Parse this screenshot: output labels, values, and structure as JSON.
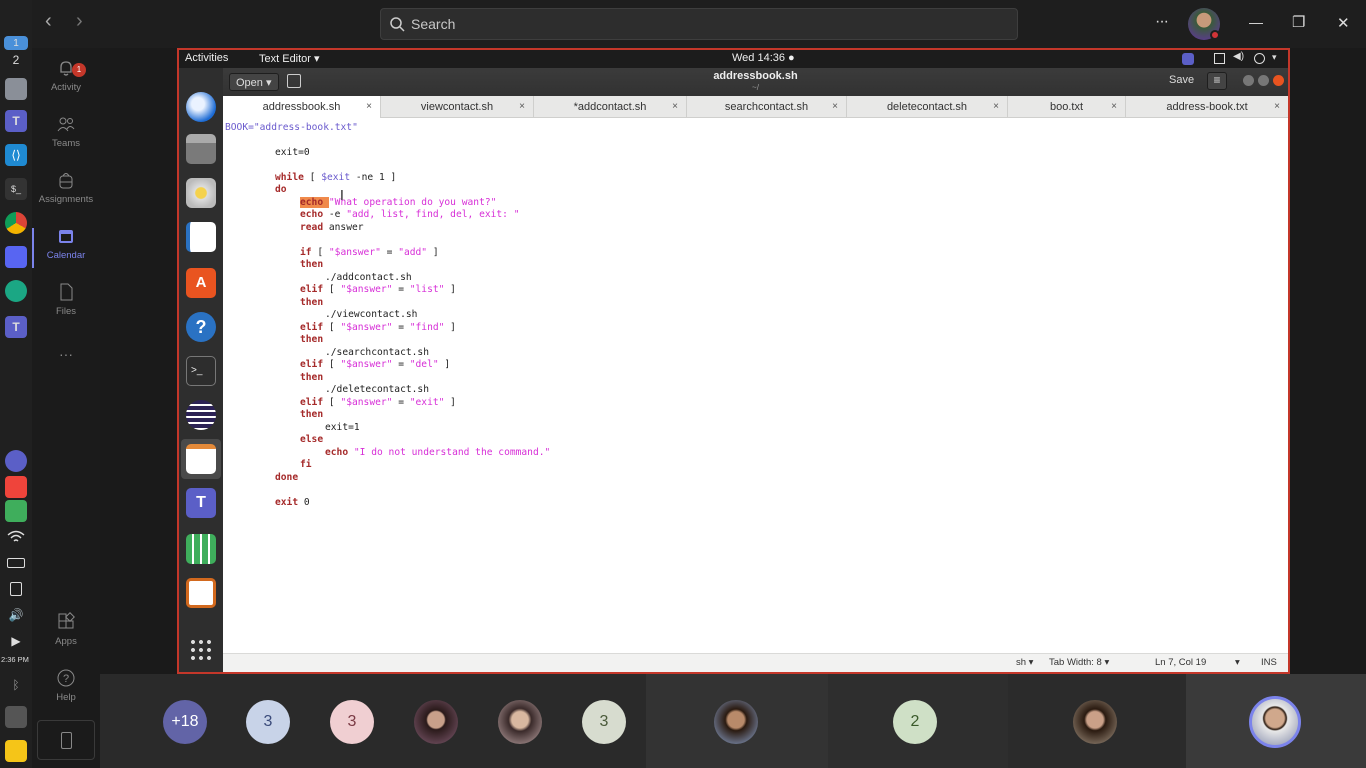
{
  "topbar": {
    "search_placeholder": "Search",
    "back_glyph": "‹",
    "forward_glyph": "›",
    "more_glyph": "···",
    "minimize_glyph": "—",
    "restore_glyph": "❐",
    "close_glyph": "✕"
  },
  "taskbar": {
    "workspace_1": "1",
    "workspace_2": "2",
    "clock": "2:36 PM"
  },
  "rail": {
    "items": [
      {
        "label": "Activity",
        "badge": "1"
      },
      {
        "label": "Teams"
      },
      {
        "label": "Assignments"
      },
      {
        "label": "Calendar"
      },
      {
        "label": "Files"
      },
      {
        "label": "···"
      },
      {
        "label": "Apps"
      },
      {
        "label": "Help"
      }
    ]
  },
  "gnome": {
    "activities": "Activities",
    "app_menu": "Text Editor ▾",
    "clock": "Wed 14:36 ●"
  },
  "gedit": {
    "open_label": "Open ▾",
    "title": "addressbook.sh",
    "subtitle": "~/",
    "save_label": "Save",
    "menu_glyph": "≡",
    "tabs": [
      {
        "label": "addressbook.sh"
      },
      {
        "label": "viewcontact.sh"
      },
      {
        "label": "*addcontact.sh"
      },
      {
        "label": "searchcontact.sh"
      },
      {
        "label": "deletecontact.sh"
      },
      {
        "label": "boo.txt"
      },
      {
        "label": "address-book.txt"
      }
    ],
    "tab_close": "×",
    "status": {
      "lang": "sh ▾",
      "tab_width": "Tab Width: 8 ▾",
      "position": "Ln 7, Col 19",
      "pos_arrow": "▾",
      "mode": "INS"
    }
  },
  "code": {
    "l1": "BOOK=\"address-book.txt\"",
    "l3": "exit=0",
    "l5a": "while",
    "l5b": " [ ",
    "l5c": "$exit",
    "l5d": " -ne 1 ]",
    "l6": "do",
    "l7a": "echo ",
    "l7b": "\"What operation do you want?\"",
    "l8a": "echo",
    "l8b": " -e ",
    "l8c": "\"add, list, find, del, exit: \"",
    "l9a": "read",
    "l9b": " answer",
    "l11a": "if",
    "l11b": " [ ",
    "l11c": "\"$answer\"",
    "l11d": " = ",
    "l11e": "\"add\"",
    "l11f": " ]",
    "then": "then",
    "l13": "./addcontact.sh",
    "elif": "elif",
    "l14c": "\"$answer\"",
    "l14e": "\"list\"",
    "l16": "./viewcontact.sh",
    "l17e": "\"find\"",
    "l19": "./searchcontact.sh",
    "l20e": "\"del\"",
    "l22": "./deletecontact.sh",
    "l23e": "\"exit\"",
    "l25": "exit=1",
    "else": "else",
    "l27a": "echo ",
    "l27b": "\"I do not understand the command.\"",
    "fi": "fi",
    "done": "done",
    "l31a": "exit",
    "l31b": " 0",
    "open_br": " [ ",
    "eq": " = ",
    "close_br": " ]"
  },
  "participants": {
    "overflow": "+18",
    "c1": "3",
    "c2": "3",
    "c3": "3",
    "c4": "2"
  }
}
